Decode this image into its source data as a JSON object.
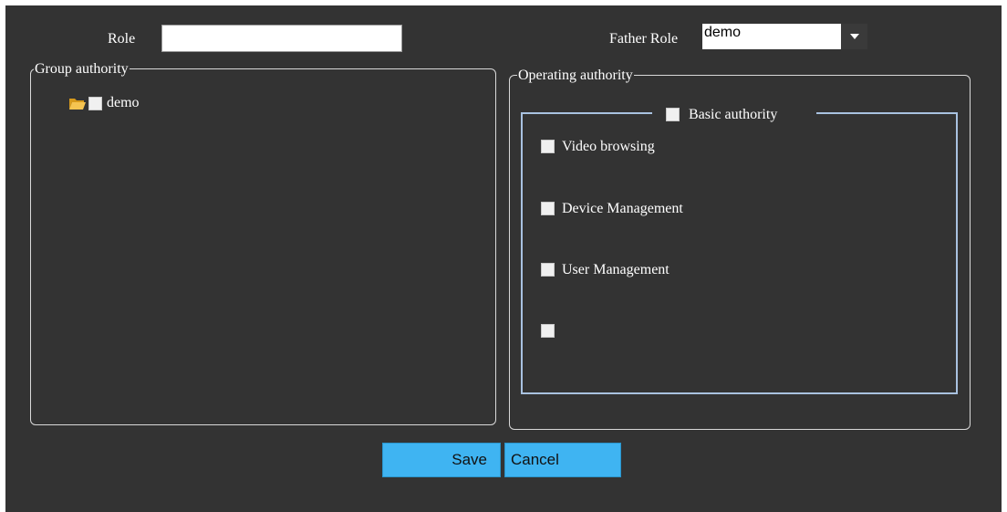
{
  "form": {
    "role_label": "Role",
    "role_value": "",
    "father_role_label": "Father Role",
    "father_role_value": "demo"
  },
  "group_authority": {
    "legend": "Group authority",
    "tree": [
      {
        "label": "demo",
        "icon": "folder-open-icon",
        "checked": false
      }
    ]
  },
  "operating_authority": {
    "legend": "Operating authority",
    "basic": {
      "legend": "Basic authority",
      "checked": false,
      "items": [
        {
          "label": "Video browsing",
          "checked": false
        },
        {
          "label": "Device Management",
          "checked": false
        },
        {
          "label": "User Management",
          "checked": false
        },
        {
          "label": "",
          "checked": false
        }
      ]
    }
  },
  "buttons": {
    "save_label": "Save",
    "cancel_label": "Cancel"
  },
  "colors": {
    "background": "#333333",
    "button": "#3fb4f2",
    "inner_border": "#a9c2e0"
  }
}
